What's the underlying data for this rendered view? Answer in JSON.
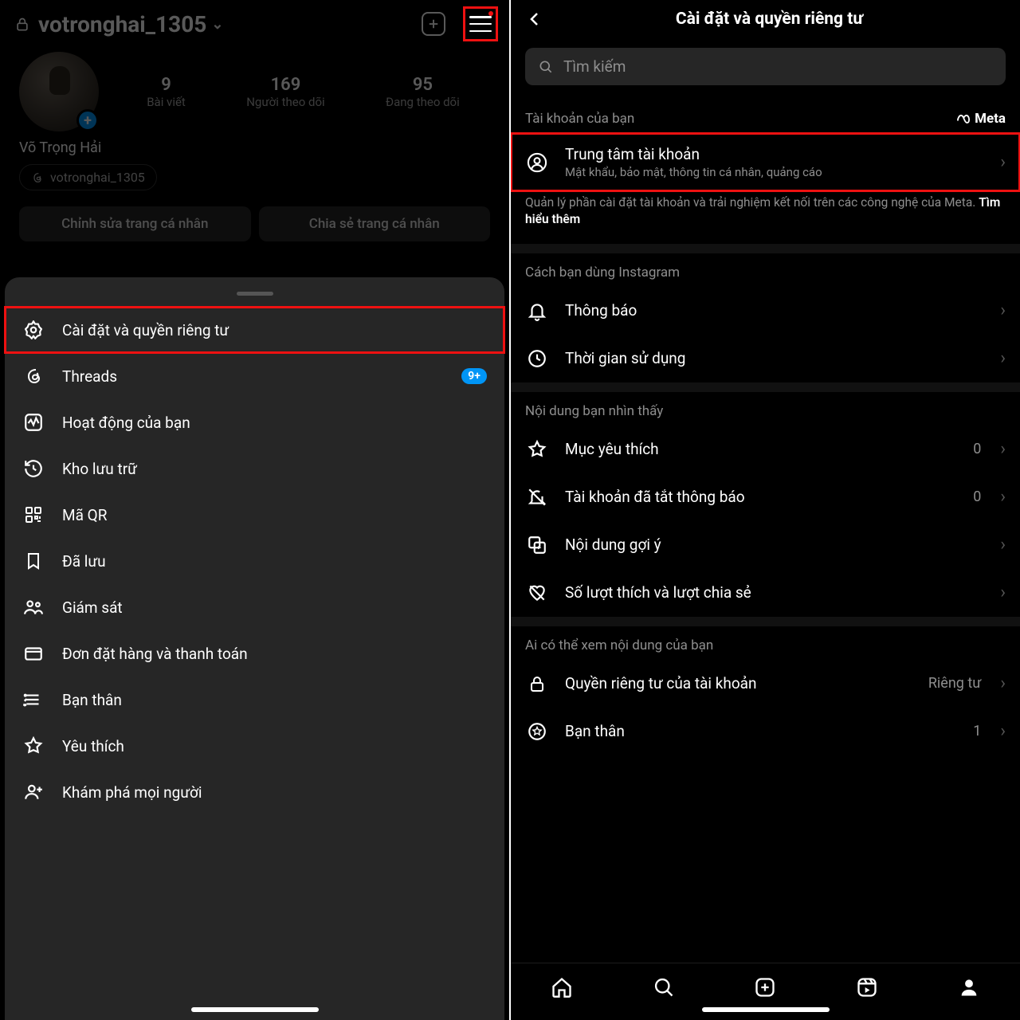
{
  "left": {
    "username": "votronghai_1305",
    "stats": {
      "posts": {
        "count": "9",
        "label": "Bài viết"
      },
      "followers": {
        "count": "169",
        "label": "Người theo dõi"
      },
      "following": {
        "count": "95",
        "label": "Đang theo dõi"
      }
    },
    "displayName": "Võ Trọng Hải",
    "threadsHandle": "votronghai_1305",
    "editProfile": "Chỉnh sửa trang cá nhân",
    "shareProfile": "Chia sẻ trang cá nhân",
    "menu": {
      "settings": "Cài đặt và quyền riêng tư",
      "threads": "Threads",
      "threadsBadge": "9+",
      "activity": "Hoạt động của bạn",
      "archive": "Kho lưu trữ",
      "qr": "Mã QR",
      "saved": "Đã lưu",
      "supervision": "Giám sát",
      "orders": "Đơn đặt hàng và thanh toán",
      "close": "Bạn thân",
      "favorites": "Yêu thích",
      "discover": "Khám phá mọi người"
    }
  },
  "right": {
    "title": "Cài đặt và quyền riêng tư",
    "searchPlaceholder": "Tìm kiếm",
    "accountSection": "Tài khoản của bạn",
    "metaLabel": "Meta",
    "accountsCenter": {
      "title": "Trung tâm tài khoản",
      "sub": "Mật khẩu, bảo mật, thông tin cá nhân, quảng cáo"
    },
    "accountsDesc1": "Quản lý phần cài đặt tài khoản và trải nghiệm kết nối trên các công nghệ của Meta. ",
    "accountsDescLink": "Tìm hiểu thêm",
    "usageSection": "Cách bạn dùng Instagram",
    "notifications": "Thông báo",
    "timeSpent": "Thời gian sử dụng",
    "contentSection": "Nội dung bạn nhìn thấy",
    "favorites": {
      "label": "Mục yêu thích",
      "count": "0"
    },
    "muted": {
      "label": "Tài khoản đã tắt thông báo",
      "count": "0"
    },
    "suggested": "Nội dung gợi ý",
    "likeShare": "Số lượt thích và lượt chia sẻ",
    "whoSeeSection": "Ai có thể xem nội dung của bạn",
    "accountPrivacy": {
      "label": "Quyền riêng tư của tài khoản",
      "value": "Riêng tư"
    },
    "closeFriends": {
      "label": "Bạn thân",
      "count": "1"
    }
  }
}
